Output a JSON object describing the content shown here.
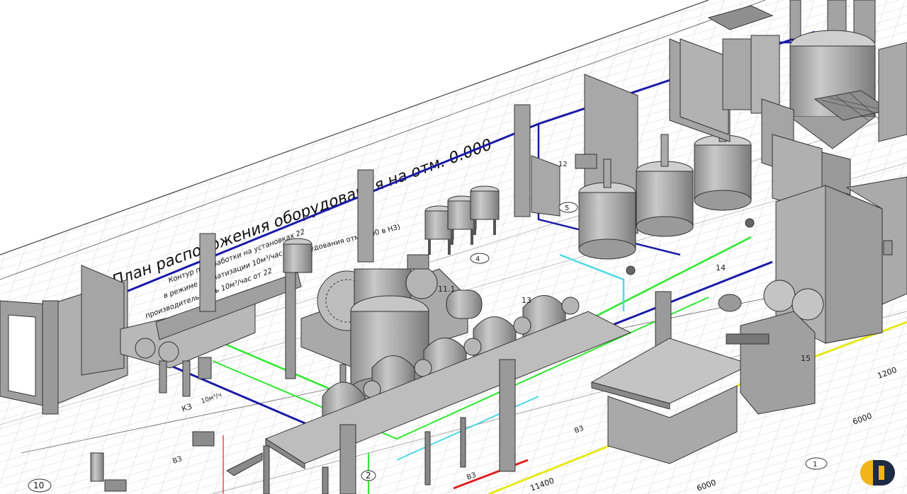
{
  "drawing": {
    "title": "План расположения оборудования на отм. 0.000",
    "notes": [
      "Контур переработки на установках 22",
      "в режиме ароматизации 10м³/час",
      "производительность 10м³/час от 22"
    ],
    "side_note": "(оборудования отм. 0,00 в Н3)",
    "callouts": [
      "1",
      "4",
      "5",
      "11.1",
      "12",
      "13",
      "14",
      "15"
    ],
    "dimensions": [
      "1200",
      "6000",
      "6000",
      "11400"
    ],
    "axes": [
      "10",
      "2",
      "4"
    ],
    "pipe_labels": [
      "К3",
      "В3",
      "В3",
      "В3",
      "10м³/ч"
    ]
  },
  "colors": {
    "blue_pipe": "#1a1aa8",
    "green_pipe": "#2ee82e",
    "cyan_pipe": "#4fd8e8",
    "yellow_pipe": "#e8e81a",
    "red_pipe": "#e02020",
    "equipment": "#a6a6a6",
    "grid": "#b8b8b8"
  },
  "logo": {
    "name": "brand-logo"
  }
}
